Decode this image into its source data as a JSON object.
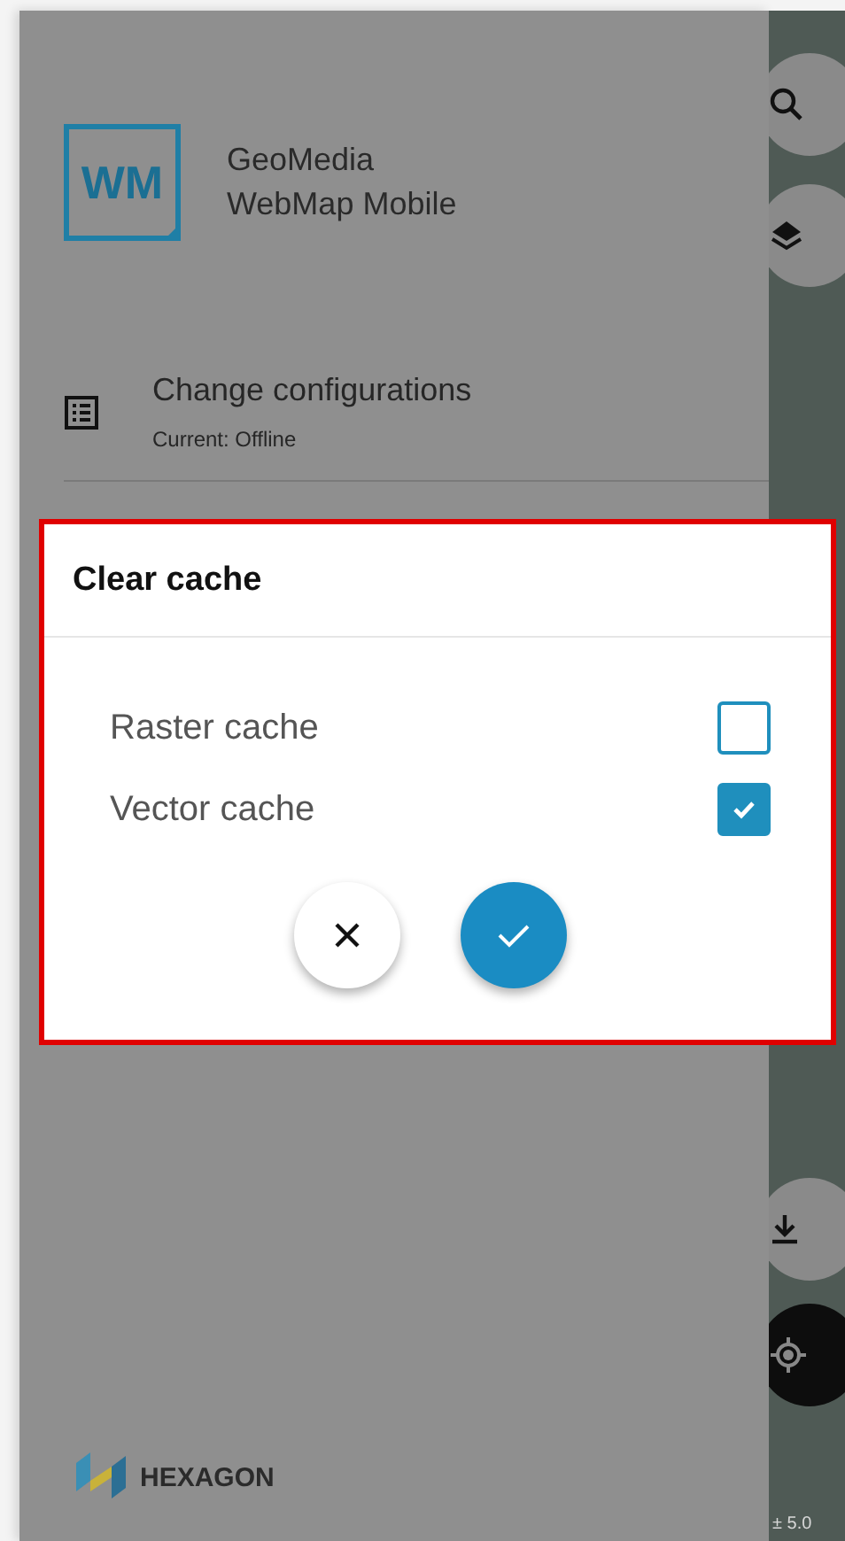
{
  "app": {
    "logo": "WM",
    "name": [
      "GeoMedia",
      "WebMap Mobile"
    ]
  },
  "menu": [
    {
      "title": "Change configurations",
      "subtitle": "Current: Offline"
    }
  ],
  "footer": {
    "brand": "HEXAGON"
  },
  "map": {
    "scale": "± 5.0"
  },
  "dialog": {
    "title": "Clear cache",
    "options": [
      {
        "label": "Raster cache",
        "checked": false
      },
      {
        "label": "Vector cache",
        "checked": true
      }
    ]
  }
}
